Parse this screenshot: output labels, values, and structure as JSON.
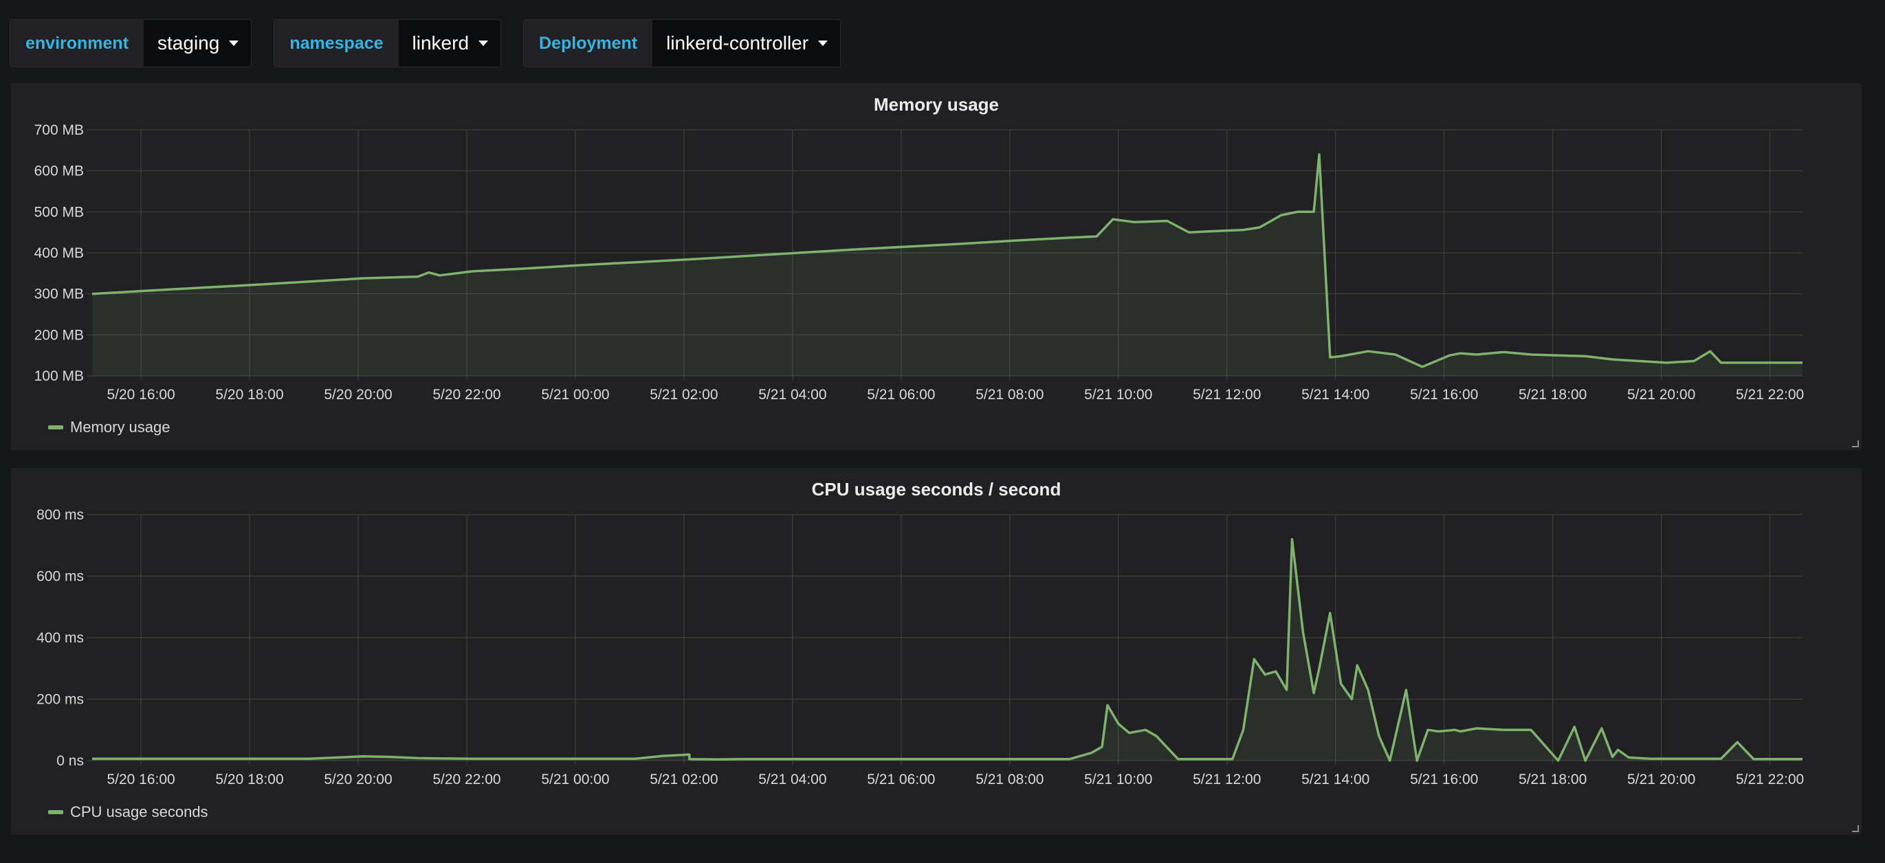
{
  "variables": [
    {
      "label": "environment",
      "value": "staging"
    },
    {
      "label": "namespace",
      "value": "linkerd"
    },
    {
      "label": "Deployment",
      "value": "linkerd-controller"
    }
  ],
  "colors": {
    "series": "#7eb26d",
    "variable_label": "#33b5e5",
    "background": "#161719",
    "panel": "#212124",
    "grid": "#464646"
  },
  "chart_data": [
    {
      "type": "area",
      "title": "Memory usage",
      "legend": "Memory usage",
      "legend_position": "bottom-left",
      "grid": true,
      "x_ticks": [
        "5/20 16:00",
        "5/20 18:00",
        "5/20 20:00",
        "5/20 22:00",
        "5/21 00:00",
        "5/21 02:00",
        "5/21 04:00",
        "5/21 06:00",
        "5/21 08:00",
        "5/21 10:00",
        "5/21 12:00",
        "5/21 14:00",
        "5/21 16:00",
        "5/21 18:00",
        "5/21 20:00",
        "5/21 22:00"
      ],
      "y_ticks": [
        "700 MB",
        "600 MB",
        "500 MB",
        "400 MB",
        "300 MB",
        "200 MB",
        "100 MB"
      ],
      "ylim": [
        100,
        700
      ],
      "y_unit": "MB",
      "x_unit": "hours since 5/20 15:00",
      "xlim": [
        0,
        31.5
      ],
      "series": [
        {
          "name": "Memory usage",
          "x": [
            0,
            2,
            3,
            4,
            5,
            6,
            6.2,
            6.4,
            7,
            8,
            9,
            10,
            11,
            12,
            13,
            14,
            15,
            16,
            17,
            18,
            18.5,
            18.8,
            19.2,
            19.8,
            20.2,
            20.5,
            21.2,
            21.5,
            21.9,
            22.2,
            22.5,
            22.6,
            22.8,
            23,
            23.5,
            24,
            24.5,
            25,
            25.2,
            25.5,
            26,
            26.5,
            27,
            27.5,
            28,
            29,
            29.5,
            29.8,
            30,
            31.5
          ],
          "y": [
            300,
            315,
            322,
            330,
            338,
            342,
            352,
            345,
            355,
            362,
            370,
            377,
            384,
            392,
            400,
            408,
            415,
            422,
            430,
            437,
            440,
            482,
            475,
            478,
            450,
            452,
            456,
            462,
            492,
            500,
            500,
            640,
            145,
            148,
            160,
            152,
            122,
            150,
            155,
            152,
            158,
            152,
            150,
            148,
            140,
            132,
            136,
            160,
            132,
            132
          ]
        }
      ]
    },
    {
      "type": "area",
      "title": "CPU usage seconds / second",
      "legend": "CPU usage seconds",
      "legend_position": "bottom-left",
      "grid": true,
      "x_ticks": [
        "5/20 16:00",
        "5/20 18:00",
        "5/20 20:00",
        "5/20 22:00",
        "5/21 00:00",
        "5/21 02:00",
        "5/21 04:00",
        "5/21 06:00",
        "5/21 08:00",
        "5/21 10:00",
        "5/21 12:00",
        "5/21 14:00",
        "5/21 16:00",
        "5/21 18:00",
        "5/21 20:00",
        "5/21 22:00"
      ],
      "y_ticks": [
        "800 ms",
        "600 ms",
        "400 ms",
        "200 ms",
        "0 ns"
      ],
      "ylim": [
        0,
        800
      ],
      "y_unit": "ms",
      "x_unit": "hours since 5/20 15:00",
      "xlim": [
        0,
        31.5
      ],
      "series": [
        {
          "name": "CPU usage seconds",
          "x": [
            0,
            4,
            4.5,
            5,
            5.5,
            6,
            7,
            10,
            10.5,
            11,
            11,
            11.5,
            12,
            18,
            18.2,
            18.4,
            18.6,
            18.7,
            18.9,
            19.1,
            19.4,
            19.6,
            20,
            20.5,
            21,
            21.2,
            21.4,
            21.6,
            21.8,
            22,
            22.1,
            22.3,
            22.5,
            22.6,
            22.8,
            23,
            23.2,
            23.3,
            23.5,
            23.7,
            23.9,
            24.2,
            24.4,
            24.6,
            24.8,
            25.1,
            25.2,
            25.5,
            26,
            26.5,
            27,
            27.3,
            27.5,
            27.8,
            28,
            28.1,
            28.3,
            28.5,
            28.7,
            28.9,
            29,
            29.5,
            30,
            30.3,
            30.6,
            30.8,
            31.5
          ],
          "y": [
            6,
            6,
            10,
            14,
            12,
            8,
            6,
            6,
            15,
            20,
            5,
            4,
            5,
            5,
            15,
            25,
            45,
            180,
            120,
            90,
            100,
            80,
            5,
            5,
            5,
            100,
            330,
            280,
            290,
            230,
            720,
            420,
            220,
            300,
            480,
            250,
            200,
            310,
            230,
            80,
            0,
            230,
            0,
            100,
            95,
            100,
            95,
            105,
            100,
            100,
            0,
            110,
            0,
            105,
            12,
            35,
            10,
            8,
            6,
            6,
            6,
            6,
            6,
            60,
            5,
            5,
            5
          ]
        }
      ]
    }
  ]
}
